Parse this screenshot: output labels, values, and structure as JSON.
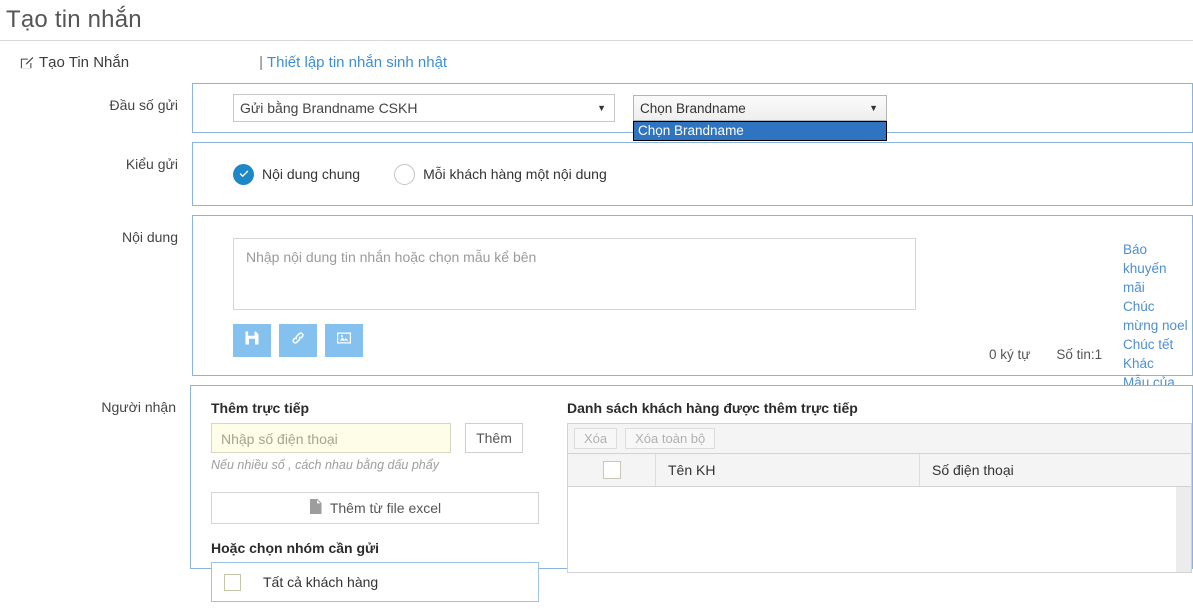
{
  "page": {
    "title": "Tạo tin nhắn"
  },
  "breadcrumb": {
    "icon": "pencil-square-icon",
    "current": "Tạo Tin Nhắn",
    "separator": "|",
    "link": "Thiết lập tin nhắn sinh nhật"
  },
  "sender": {
    "label": "Đầu số gửi",
    "method_selected": "Gửi bằng Brandname CSKH",
    "brand_selected": "Chọn Brandname",
    "brand_options": [
      "Chọn Brandname"
    ],
    "brand_dropdown_open": true,
    "caret": "▼"
  },
  "send_type": {
    "label": "Kiểu gửi",
    "options": [
      {
        "label": "Nội dung chung",
        "selected": true
      },
      {
        "label": "Mỗi khách hàng một nội dung",
        "selected": false
      }
    ]
  },
  "content": {
    "label": "Nội dung",
    "placeholder": "Nhập nội dung tin nhắn hoặc chọn mẫu kể bên",
    "value": "",
    "tools": [
      {
        "name": "save-icon",
        "title": "save"
      },
      {
        "name": "link-icon",
        "title": "link"
      },
      {
        "name": "image-icon",
        "title": "image"
      }
    ],
    "templates": [
      "Báo khuyến mãi",
      "Chúc mừng noel",
      "Chúc tết",
      "Khác",
      "Mẫu của bạn"
    ],
    "char_count": "0 ký tự",
    "sms_count": "Số tin:1"
  },
  "recipients": {
    "label": "Người nhận",
    "direct_head": "Thêm trực tiếp",
    "phone_placeholder": "Nhập số điện thoại",
    "phone_value": "",
    "add_button": "Thêm",
    "hint": "Nếu nhiều số , cách nhau bằng dấu phẩy",
    "excel_button": "Thêm từ file excel",
    "excel_icon": "file-icon",
    "group_head": "Hoặc chọn nhóm cần gửi",
    "group_first": "Tất cả khách hàng",
    "list_head": "Danh sách khách hàng được thêm trực tiếp",
    "delete_button": "Xóa",
    "delete_all_button": "Xóa toàn bộ",
    "columns": [
      "",
      "Tên KH",
      "Số điện thoại"
    ],
    "rows": []
  },
  "colors": {
    "panel_border": "#8ab4dd",
    "link": "#4e8fd1",
    "accent": "#1e88c7",
    "tool_button": "#84c1ef",
    "dropdown_highlight": "#2f74c0",
    "input_yellow": "#fdfde8"
  }
}
